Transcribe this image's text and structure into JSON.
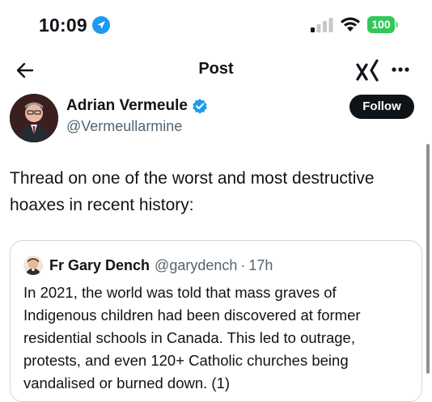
{
  "status_bar": {
    "time": "10:09",
    "battery": "100",
    "battery_color": "#34c759"
  },
  "nav": {
    "title": "Post",
    "back_icon": "arrow-left-icon",
    "grok_icon": "grok-icon",
    "more_icon": "more-icon"
  },
  "author": {
    "name": "Adrian Vermeule",
    "handle": "@Vermeullarmine",
    "verified_color": "#1d9bf0"
  },
  "follow_label": "Follow",
  "tweet": {
    "text": "Thread on one of the worst and most destructive hoaxes in recent history:"
  },
  "quote": {
    "name": "Fr Gary Dench",
    "handle": "@garydench",
    "separator": "·",
    "time": "17h",
    "text": "In 2021, the world was told that mass graves of Indigenous children had been discovered at former residential schools in Canada. This led to outrage, protests, and even 120+ Catholic churches being vandalised or burned down. (1)"
  }
}
